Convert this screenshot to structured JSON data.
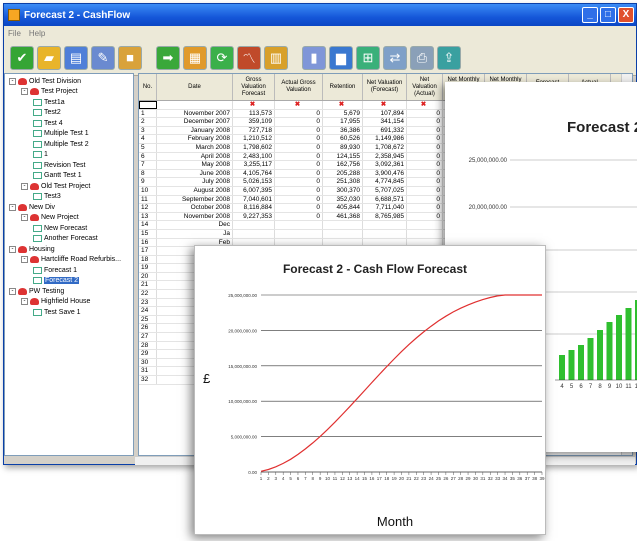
{
  "window": {
    "title": "Forecast 2 - CashFlow",
    "minimize": "_",
    "maximize": "□",
    "close": "X"
  },
  "menu": [
    "File",
    "Help"
  ],
  "toolbar": [
    {
      "icon": "check-icon",
      "color": "#35a535"
    },
    {
      "icon": "folder-icon",
      "color": "#e8b42a"
    },
    {
      "icon": "document-icon",
      "color": "#4f7fd8"
    },
    {
      "icon": "edit-icon",
      "color": "#6a8ad0"
    },
    {
      "icon": "box-icon",
      "color": "#d9a23a"
    },
    {
      "icon": "arrow-right-icon",
      "color": "#3aa83a"
    },
    {
      "icon": "calendar-icon",
      "color": "#e09a2a"
    },
    {
      "icon": "refresh-icon",
      "color": "#3bb04a"
    },
    {
      "icon": "chart-line-icon",
      "color": "#c04a2a"
    },
    {
      "icon": "table-edit-icon",
      "color": "#d8a02a"
    },
    {
      "icon": "columns-icon",
      "color": "#7f96d8"
    },
    {
      "icon": "bar-chart-icon",
      "color": "#3a78d0"
    },
    {
      "icon": "add-window-icon",
      "color": "#3ab07a"
    },
    {
      "icon": "transfer-icon",
      "color": "#7fa0c8"
    },
    {
      "icon": "print-icon",
      "color": "#8aa0b8"
    },
    {
      "icon": "export-icon",
      "color": "#3aa0a0"
    }
  ],
  "tree": [
    {
      "level": 0,
      "toggle": "-",
      "type": "div",
      "label": "Old Test Division"
    },
    {
      "level": 1,
      "toggle": "-",
      "type": "div",
      "label": "Test Project"
    },
    {
      "level": 2,
      "type": "doc",
      "label": "Test1a"
    },
    {
      "level": 2,
      "type": "doc",
      "label": "Test2"
    },
    {
      "level": 2,
      "type": "doc",
      "label": "Test 4"
    },
    {
      "level": 2,
      "type": "doc",
      "label": "Multiple Test 1"
    },
    {
      "level": 2,
      "type": "doc",
      "label": "Multiple Test 2"
    },
    {
      "level": 2,
      "type": "doc",
      "label": "1"
    },
    {
      "level": 2,
      "type": "doc",
      "label": "Revision Test"
    },
    {
      "level": 2,
      "type": "doc",
      "label": "Gantt Test 1"
    },
    {
      "level": 1,
      "toggle": "-",
      "type": "div",
      "label": "Old Test Project"
    },
    {
      "level": 2,
      "type": "doc",
      "label": "Test3"
    },
    {
      "level": 0,
      "toggle": "-",
      "type": "div",
      "label": "New Div"
    },
    {
      "level": 1,
      "toggle": "-",
      "type": "div",
      "label": "New Project"
    },
    {
      "level": 2,
      "type": "doc",
      "label": "New Forecast"
    },
    {
      "level": 2,
      "type": "doc",
      "label": "Another Forecast"
    },
    {
      "level": 0,
      "toggle": "-",
      "type": "div",
      "label": "Housing"
    },
    {
      "level": 1,
      "toggle": "-",
      "type": "div",
      "label": "Hartcliffe Road Refurbis..."
    },
    {
      "level": 2,
      "type": "doc",
      "label": "Forecast 1"
    },
    {
      "level": 2,
      "type": "doc",
      "label": "Forecast 2",
      "selected": true
    },
    {
      "level": 0,
      "toggle": "-",
      "type": "div",
      "label": "PW Testing"
    },
    {
      "level": 1,
      "toggle": "-",
      "type": "div",
      "label": "Highfield House"
    },
    {
      "level": 2,
      "type": "doc",
      "label": "Test Save 1"
    }
  ],
  "grid": {
    "headers": [
      "No.",
      "Date",
      "Gross Valuation Forecast",
      "Actual Gross Valuation",
      "Retention",
      "Net Valuation (Forecast)",
      "Net Valuation (Actual)",
      "Net Monthly Payment (Forecast)",
      "Net Monthly Payment (Actual)",
      "Forecast Retention",
      "Actual Retention"
    ],
    "marker": "✖",
    "rows": [
      [
        "1",
        "November 2007",
        "113,573",
        "0",
        "5,679",
        "107,894",
        "0"
      ],
      [
        "2",
        "December 2007",
        "359,109",
        "0",
        "17,955",
        "341,154",
        "0"
      ],
      [
        "3",
        "January 2008",
        "727,718",
        "0",
        "36,386",
        "691,332",
        "0"
      ],
      [
        "4",
        "February 2008",
        "1,210,512",
        "0",
        "60,526",
        "1,149,986",
        "0"
      ],
      [
        "5",
        "March 2008",
        "1,798,602",
        "0",
        "89,930",
        "1,708,672",
        "0"
      ],
      [
        "6",
        "April 2008",
        "2,483,100",
        "0",
        "124,155",
        "2,358,945",
        "0"
      ],
      [
        "7",
        "May 2008",
        "3,255,117",
        "0",
        "162,756",
        "3,092,361",
        "0"
      ],
      [
        "8",
        "June 2008",
        "4,105,764",
        "0",
        "205,288",
        "3,900,476",
        "0"
      ],
      [
        "9",
        "July 2008",
        "5,026,153",
        "0",
        "251,308",
        "4,774,845",
        "0"
      ],
      [
        "10",
        "August 2008",
        "6,007,395",
        "0",
        "300,370",
        "5,707,025",
        "0"
      ],
      [
        "11",
        "September 2008",
        "7,040,601",
        "0",
        "352,030",
        "6,688,571",
        "0"
      ],
      [
        "12",
        "October 2008",
        "8,116,884",
        "0",
        "405,844",
        "7,711,040",
        "0"
      ],
      [
        "13",
        "November 2008",
        "9,227,353",
        "0",
        "461,368",
        "8,765,985",
        "0"
      ],
      [
        "14",
        "Dec"
      ],
      [
        "15",
        "Ja"
      ],
      [
        "16",
        "Feb"
      ],
      [
        "17",
        "M"
      ],
      [
        "18",
        ""
      ],
      [
        "19",
        ""
      ],
      [
        "20",
        ""
      ],
      [
        "21",
        ""
      ],
      [
        "22",
        "A"
      ],
      [
        "23",
        "Septe"
      ],
      [
        "24",
        "Oc"
      ],
      [
        "25",
        "Nove"
      ],
      [
        "26",
        "Dece"
      ],
      [
        "27",
        "Ja"
      ],
      [
        "28",
        "Feb"
      ],
      [
        "29",
        "M"
      ],
      [
        "30",
        ""
      ],
      [
        "31",
        ""
      ],
      [
        "32",
        ""
      ]
    ]
  },
  "chart_data": [
    {
      "type": "bar",
      "title": "Forecast 2 -",
      "ytick_labels": [
        "25,000,000.00",
        "20,000,000.00"
      ],
      "xtick_labels": [
        "4",
        "5",
        "6",
        "7",
        "8",
        "9",
        "10",
        "11",
        "12"
      ],
      "values": [
        2.5,
        3,
        3.5,
        4.2,
        5,
        5.8,
        6.5,
        7.2,
        8
      ],
      "color": "#2fbf2f"
    },
    {
      "type": "line",
      "title": "Forecast 2 - Cash Flow Forecast",
      "ylabel": "£",
      "xlabel": "Month",
      "ylim": [
        0,
        25000000
      ],
      "ytick_labels": [
        "0.00",
        "5,000,000.00",
        "10,000,000.00",
        "15,000,000.00",
        "20,000,000.00",
        "25,000,000.00"
      ],
      "x": [
        1,
        2,
        3,
        4,
        5,
        6,
        7,
        8,
        9,
        10,
        11,
        12,
        13,
        14,
        15,
        16,
        17,
        18,
        19,
        20,
        21,
        22,
        23,
        24,
        25,
        26,
        27,
        28,
        29,
        30,
        31,
        32,
        33,
        34,
        35,
        36,
        37,
        38,
        39
      ],
      "y": [
        100000,
        350000,
        730000,
        1210000,
        1800000,
        2480000,
        3260000,
        4110000,
        5030000,
        6010000,
        7040000,
        8120000,
        9230000,
        10360000,
        11500000,
        12640000,
        13770000,
        14880000,
        15960000,
        17000000,
        17990000,
        18920000,
        19790000,
        20600000,
        21340000,
        22010000,
        22610000,
        23140000,
        23600000,
        24000000,
        24350000,
        24640000,
        24870000,
        25000000,
        25000000,
        25000000,
        25000000,
        25000000,
        25000000
      ],
      "color": "#e03030",
      "grid": true
    }
  ]
}
